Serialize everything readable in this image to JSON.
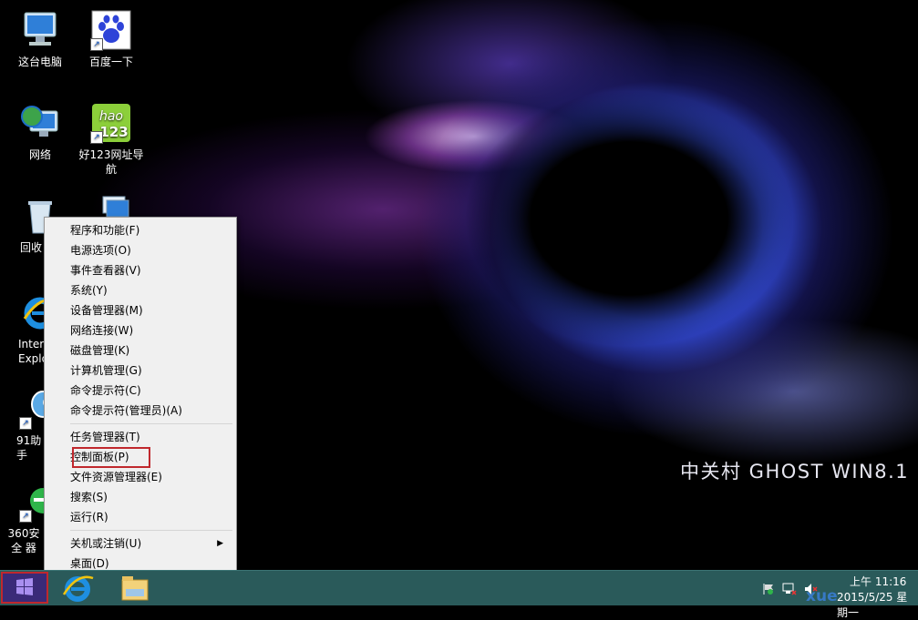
{
  "desktop": {
    "wallpaper_caption": "中关村 GHOST WIN8.1",
    "icons": [
      {
        "label": "这台电脑"
      },
      {
        "label": "百度一下"
      },
      {
        "label": "网络"
      },
      {
        "label": "好123网址导航",
        "badge": "hao 123"
      },
      {
        "label": "回收"
      },
      {
        "label": "Inter Explo"
      },
      {
        "label": "91助手"
      },
      {
        "label": "360安全 器"
      }
    ]
  },
  "context_menu": {
    "items": [
      {
        "label": "程序和功能(F)"
      },
      {
        "label": "电源选项(O)"
      },
      {
        "label": "事件查看器(V)"
      },
      {
        "label": "系统(Y)"
      },
      {
        "label": "设备管理器(M)"
      },
      {
        "label": "网络连接(W)"
      },
      {
        "label": "磁盘管理(K)"
      },
      {
        "label": "计算机管理(G)"
      },
      {
        "label": "命令提示符(C)"
      },
      {
        "label": "命令提示符(管理员)(A)"
      },
      {
        "label": "任务管理器(T)"
      },
      {
        "label": "控制面板(P)"
      },
      {
        "label": "文件资源管理器(E)"
      },
      {
        "label": "搜索(S)"
      },
      {
        "label": "运行(R)"
      },
      {
        "label": "关机或注销(U)",
        "has_submenu": true
      },
      {
        "label": "桌面(D)"
      }
    ],
    "highlighted_item": "控制面板(P)"
  },
  "taskbar": {
    "start_icon": "windows-logo-icon",
    "pinned": [
      "internet-explorer-icon",
      "file-explorer-icon"
    ],
    "tray": {
      "time": "上午 11:16",
      "date": "2015/5/25 星期一",
      "icons": [
        "action-center-flag-icon",
        "network-icon",
        "volume-icon"
      ]
    },
    "watermark": "xue"
  },
  "colors": {
    "taskbar": "#2a5a5a",
    "start_highlight": "#c0282d",
    "menu_background": "#f0f0f0"
  }
}
